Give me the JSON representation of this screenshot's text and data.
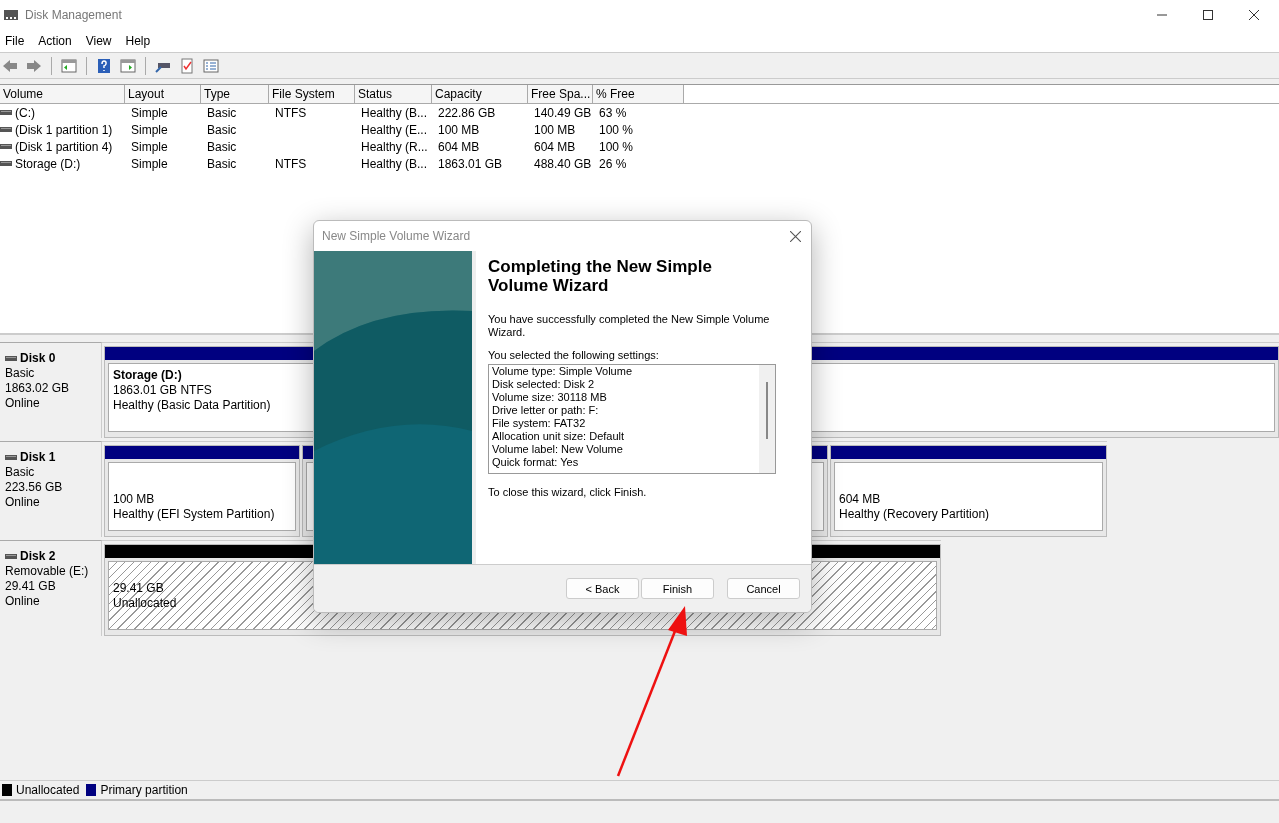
{
  "window": {
    "title": "Disk Management"
  },
  "menu": [
    "File",
    "Action",
    "View",
    "Help"
  ],
  "volumes": {
    "columns": [
      "Volume",
      "Layout",
      "Type",
      "File System",
      "Status",
      "Capacity",
      "Free Spa...",
      "% Free"
    ],
    "rows": [
      {
        "cells": [
          " (C:)",
          "Simple",
          "Basic",
          "NTFS",
          "Healthy (B...",
          "222.86 GB",
          "140.49 GB",
          "63 %"
        ]
      },
      {
        "cells": [
          "(Disk 1 partition 1)",
          "Simple",
          "Basic",
          "",
          "Healthy (E...",
          "100 MB",
          "100 MB",
          "100 %"
        ]
      },
      {
        "cells": [
          "(Disk 1 partition 4)",
          "Simple",
          "Basic",
          "",
          "Healthy (R...",
          "604 MB",
          "604 MB",
          "100 %"
        ]
      },
      {
        "cells": [
          "Storage (D:)",
          "Simple",
          "Basic",
          "NTFS",
          "Healthy (B...",
          "1863.01 GB",
          "488.40 GB",
          "26 %"
        ]
      }
    ]
  },
  "disks": [
    {
      "name": "Disk 0",
      "details": [
        "Basic",
        "1863.02 GB",
        "Online"
      ],
      "partitions": [
        {
          "kind": "primary",
          "title": "Storage  (D:)",
          "lines": [
            "1863.01 GB NTFS",
            "Healthy (Basic Data Partition)"
          ]
        }
      ]
    },
    {
      "name": "Disk 1",
      "details": [
        "Basic",
        "223.56 GB",
        "Online"
      ],
      "partitions": [
        {
          "kind": "primary",
          "lines": [
            "100 MB",
            "Healthy (EFI System Partition)"
          ]
        },
        {
          "kind": "primary"
        },
        {
          "kind": "primary",
          "lines": [
            "604 MB",
            "Healthy (Recovery Partition)"
          ]
        }
      ]
    },
    {
      "name": "Disk 2",
      "details": [
        "Removable (E:)",
        "29.41 GB",
        "Online"
      ],
      "partitions": [
        {
          "kind": "unallocated",
          "lines": [
            "29.41 GB",
            "Unallocated"
          ]
        }
      ]
    }
  ],
  "legend": [
    {
      "label": "Unallocated",
      "color": "#000000"
    },
    {
      "label": "Primary partition",
      "color": "#000080"
    }
  ],
  "dialog": {
    "title": "New Simple Volume Wizard",
    "heading": "Completing the New Simple Volume Wizard",
    "intro": "You have successfully completed the New Simple Volume Wizard.",
    "settings_label": "You selected the following settings:",
    "settings": [
      "Volume type: Simple Volume",
      "Disk selected: Disk 2",
      "Volume size: 30118 MB",
      "Drive letter or path: F:",
      "File system: FAT32",
      "Allocation unit size: Default",
      "Volume label: New Volume",
      "Quick format: Yes"
    ],
    "closing": "To close this wizard, click Finish.",
    "buttons": [
      "< Back",
      "Finish",
      "Cancel"
    ]
  }
}
